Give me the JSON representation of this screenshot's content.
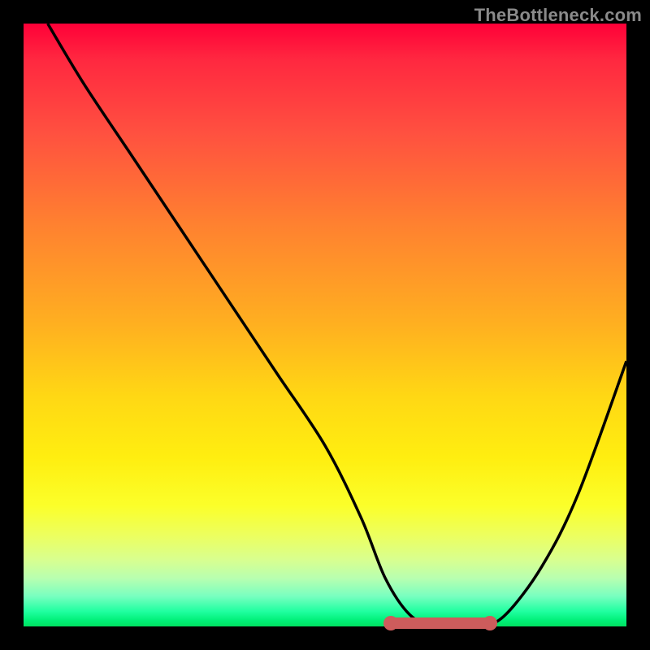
{
  "watermark": "TheBottleneck.com",
  "colors": {
    "frame": "#000000",
    "curve": "#000000",
    "marker": "#cd5c5c",
    "watermark": "#8a8a8a"
  },
  "chart_data": {
    "type": "line",
    "title": "",
    "xlabel": "",
    "ylabel": "",
    "xlim": [
      0,
      100
    ],
    "ylim": [
      0,
      100
    ],
    "series": [
      {
        "name": "bottleneck-curve",
        "x": [
          4,
          10,
          18,
          26,
          34,
          42,
          50,
          56,
          60,
          64,
          68,
          72,
          76,
          80,
          86,
          92,
          100
        ],
        "values": [
          100,
          90,
          78,
          66,
          54,
          42,
          30,
          18,
          8,
          2,
          0,
          0,
          0,
          2,
          10,
          22,
          44
        ]
      }
    ],
    "marker_region": {
      "x_start": 60,
      "x_end": 78,
      "y": 0.5
    },
    "annotations": []
  }
}
